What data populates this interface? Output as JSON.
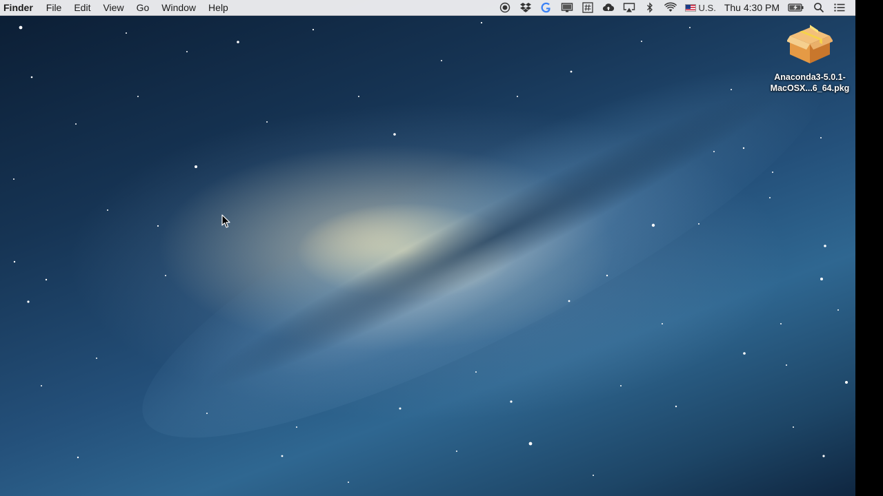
{
  "menubar": {
    "app_name": "Finder",
    "menus": [
      "File",
      "Edit",
      "View",
      "Go",
      "Window",
      "Help"
    ],
    "status_icons": [
      "record-icon",
      "dropbox-icon",
      "google-icon",
      "display-icon",
      "hashtag-icon",
      "cloud-upload-icon",
      "airplay-icon",
      "bluetooth-icon",
      "wifi-icon"
    ],
    "input_source": "U.S.",
    "clock": "Thu 4:30 PM",
    "right_icons": [
      "battery-charging-icon",
      "spotlight-search-icon",
      "notification-center-icon"
    ]
  },
  "desktop": {
    "icons": [
      {
        "name": "Anaconda3-5.0.1-",
        "name_line2": "MacOSX...6_64.pkg",
        "type": "package-icon"
      }
    ]
  },
  "colors": {
    "menubar_bg": "#eeeef0",
    "package_box": "#e9a44c",
    "package_ribbon": "#f6d34a"
  }
}
